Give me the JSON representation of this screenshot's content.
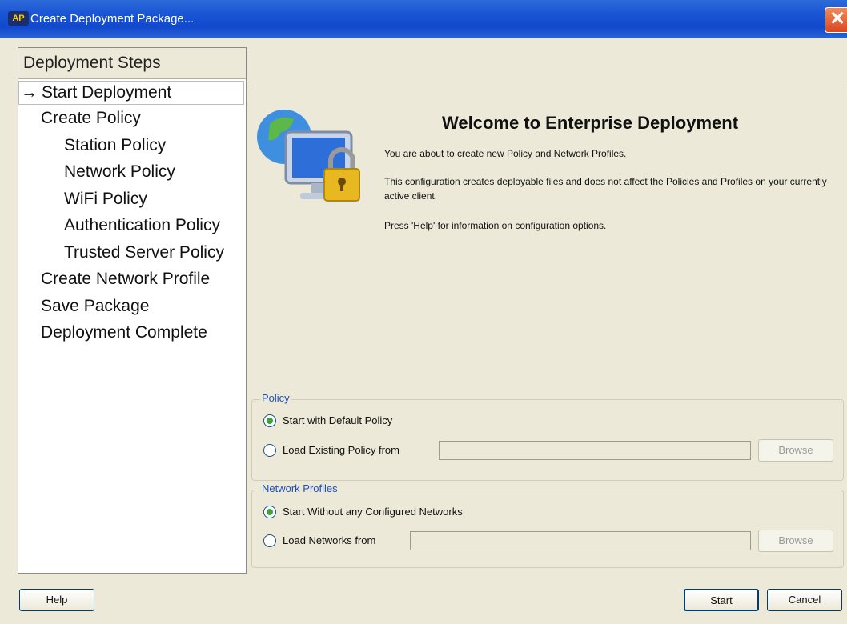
{
  "window": {
    "title": "Create Deployment Package...",
    "app_icon_text": "AP"
  },
  "steps": {
    "header": "Deployment Steps",
    "items": [
      {
        "label": "Start Deployment",
        "indent": 0,
        "current": true
      },
      {
        "label": "Create Policy",
        "indent": 1
      },
      {
        "label": "Station Policy",
        "indent": 2
      },
      {
        "label": "Network Policy",
        "indent": 2
      },
      {
        "label": "WiFi Policy",
        "indent": 2
      },
      {
        "label": "Authentication Policy",
        "indent": 2
      },
      {
        "label": "Trusted Server Policy",
        "indent": 2
      },
      {
        "label": "Create Network Profile",
        "indent": 1
      },
      {
        "label": "Save Package",
        "indent": 1
      },
      {
        "label": "Deployment Complete",
        "indent": 1
      }
    ]
  },
  "welcome": {
    "title": "Welcome to Enterprise Deployment",
    "line1": "You are about to create new Policy and Network Profiles.",
    "line2": "This configuration creates deployable files and does not affect the Policies and Profiles on your currently active client.",
    "line3": "Press 'Help' for information on configuration options."
  },
  "policy": {
    "label": "Policy",
    "option_default": "Start with Default Policy",
    "option_load": "Load Existing Policy from",
    "path_value": "",
    "browse": "Browse",
    "selected": "default"
  },
  "network_profiles": {
    "label": "Network Profiles",
    "option_default": "Start Without any Configured Networks",
    "option_load": "Load Networks from",
    "path_value": "",
    "browse": "Browse",
    "selected": "default"
  },
  "buttons": {
    "help": "Help",
    "start": "Start",
    "cancel": "Cancel"
  },
  "colors": {
    "accent": "#1f4fbf",
    "radio_selected": "#3ca33c",
    "titlebar": "#1a55d6"
  }
}
